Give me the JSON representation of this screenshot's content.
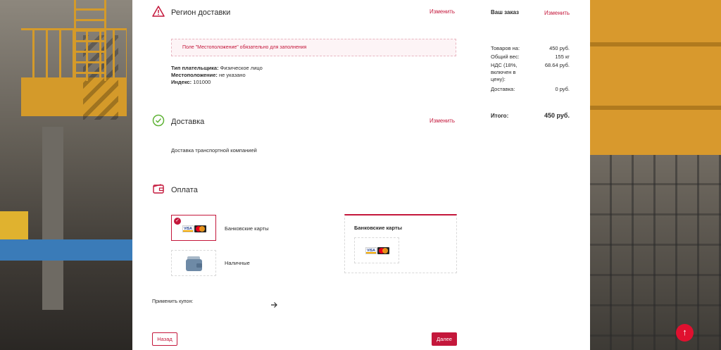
{
  "delivery_region": {
    "title": "Регион доставки",
    "edit_label": "Изменить",
    "alert": "Поле \"Местоположение\" обязательно для заполнения",
    "payer_type_label": "Тип плательщика:",
    "payer_type_value": "Физическое лицо",
    "location_label": "Местоположение:",
    "location_value": "не указано",
    "index_label": "Индекс:",
    "index_value": "101000"
  },
  "shipping": {
    "title": "Доставка",
    "edit_label": "Изменить",
    "method": "Доставка транспортной компанией"
  },
  "payment": {
    "title": "Оплата",
    "options": [
      {
        "label": "Банковские карты",
        "selected": true
      },
      {
        "label": "Наличные",
        "selected": false
      }
    ],
    "selected_box_title": "Банковские карты",
    "coupon_label": "Применить купон:"
  },
  "buttons": {
    "back": "Назад",
    "next": "Далее"
  },
  "summary": {
    "title": "Ваш заказ",
    "edit_label": "Изменить",
    "rows": [
      {
        "label": "Товаров на:",
        "value": "450 руб."
      },
      {
        "label": "Общий вес:",
        "value": "155 кг"
      },
      {
        "label": "НДС (18%, включен в цену):",
        "value": "68.64 руб."
      },
      {
        "label": "Доставка:",
        "value": "0 руб."
      }
    ],
    "total_label": "Итого:",
    "total_value": "450 руб."
  },
  "icons": {
    "region": "warning-triangle-icon",
    "shipping": "check-circle-icon",
    "payment": "wallet-icon",
    "coupon_arrow": "arrow-right-icon",
    "scroll_top": "arrow-up-icon",
    "cash": "wallet-icon"
  },
  "colors": {
    "accent": "#c4173b",
    "success": "#5fb336",
    "scroll_button": "#e0102f"
  }
}
